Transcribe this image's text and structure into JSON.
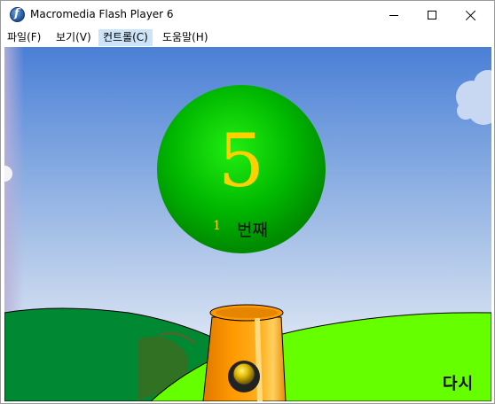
{
  "window": {
    "title": "Macromedia Flash Player 6",
    "icon": "flash-player-icon",
    "controls": [
      "minimize-icon",
      "maximize-icon",
      "close-icon"
    ]
  },
  "menu": {
    "items": [
      {
        "label": "파일(F)"
      },
      {
        "label": "보기(V)"
      },
      {
        "label": "컨트롤(C)"
      },
      {
        "label": "도움말(H)"
      }
    ],
    "active_index": 2
  },
  "game": {
    "ball_number": "5",
    "counter_value": "1",
    "counter_suffix": "번째",
    "retry_label": "다시"
  },
  "colors": {
    "ball": "#00cc00",
    "number_text": "#ffd000",
    "cannon": "#ff9900",
    "hill_front": "#66ff00",
    "hill_back": "#008833"
  }
}
